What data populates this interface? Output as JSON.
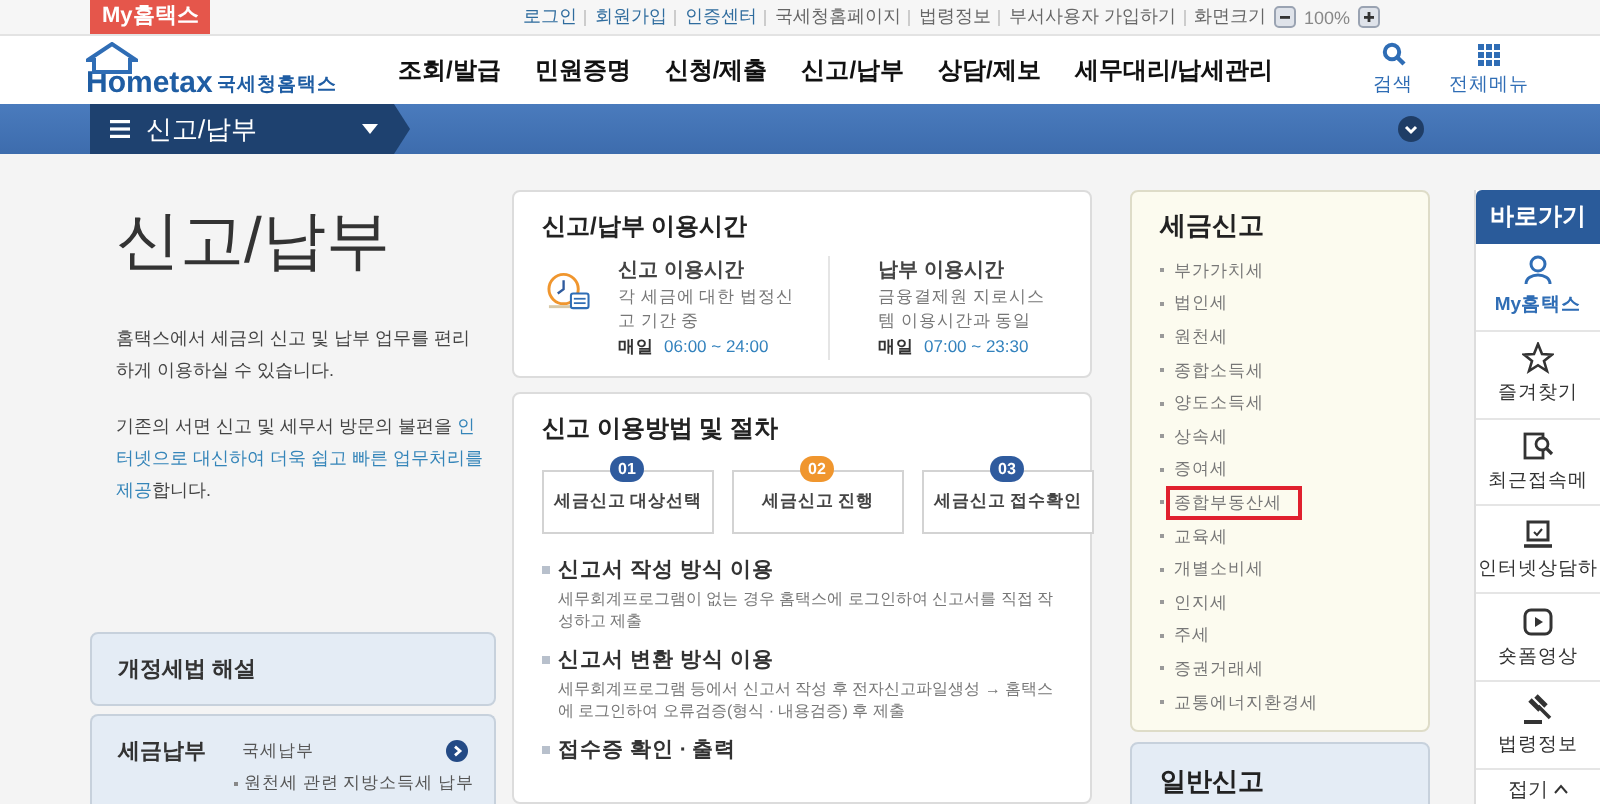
{
  "top_bar": {
    "badge": "My홈택스",
    "links": [
      {
        "label": "로그인",
        "emphasis": true
      },
      {
        "label": "회원가입",
        "emphasis": true
      },
      {
        "label": "인증센터",
        "emphasis": true
      },
      {
        "label": "국세청홈페이지",
        "emphasis": false
      },
      {
        "label": "법령정보",
        "emphasis": false
      },
      {
        "label": "부서사용자 가입하기",
        "emphasis": false
      },
      {
        "label": "화면크기",
        "emphasis": false
      }
    ],
    "zoom": "100%"
  },
  "header": {
    "logo_text": "Hometax",
    "logo_subtitle": "국세청홈택스",
    "menu": [
      "조회/발급",
      "민원증명",
      "신청/제출",
      "신고/납부",
      "상담/제보",
      "세무대리/납세관리"
    ],
    "search_label": "검색",
    "all_menu_label": "전체메뉴"
  },
  "breadcrumb_bar": {
    "current": "신고/납부"
  },
  "intro": {
    "title": "신고/납부",
    "paragraphs": [
      {
        "text": "홈택스에서 세금의 신고 및 납부 업무를 편리하게 이용하실 수 있습니다."
      },
      {
        "text": "기존의 서면 신고 및 세무서 방문의 불편을 ",
        "highlight": "인터넷으로 대신하여 더욱 쉽고 빠른 업무처리를 제공",
        "after": "합니다."
      }
    ]
  },
  "left_panels": [
    {
      "title": "개정세법 해설"
    },
    {
      "title": "세금납부",
      "link": "국세납부",
      "items": [
        "원천세 관련 지방소득세 납부"
      ]
    }
  ],
  "usage_hours": {
    "title": "신고/납부 이용시간",
    "columns": [
      {
        "title": "신고 이용시간",
        "desc": "각 세금에 대한 법정신고 기간 중",
        "label": "매일",
        "time": "06:00 ~ 24:00"
      },
      {
        "title": "납부 이용시간",
        "desc": "금융결제원 지로시스템 이용시간과 동일",
        "label": "매일",
        "time": "07:00 ~ 23:30"
      }
    ]
  },
  "procedure": {
    "title": "신고 이용방법 및 절차",
    "steps": [
      {
        "number": "01",
        "label": "세금신고 대상선택",
        "color": "#2f5b9e"
      },
      {
        "number": "02",
        "label": "세금신고 진행",
        "color": "#f0962e"
      },
      {
        "number": "03",
        "label": "세금신고 접수확인",
        "color": "#2f5b9e"
      }
    ],
    "methods": [
      {
        "title": "신고서 작성 방식 이용",
        "desc": "세무회계프로그램이 없는 경우 홈택스에 로그인하여 신고서를 직접 작성하고 제출"
      },
      {
        "title": "신고서 변환 방식 이용",
        "desc": "세무회계프로그램 등에서 신고서 작성 후 전자신고파일생성 → 홈택스에 로그인하여 오류검증(형식 · 내용검증) 후 제출"
      },
      {
        "title": "접수증 확인 · 출력"
      }
    ]
  },
  "tax_filing": {
    "title": "세금신고",
    "items": [
      {
        "label": "부가가치세",
        "highlighted": false
      },
      {
        "label": "법인세",
        "highlighted": false
      },
      {
        "label": "원천세",
        "highlighted": false
      },
      {
        "label": "종합소득세",
        "highlighted": false
      },
      {
        "label": "양도소득세",
        "highlighted": false
      },
      {
        "label": "상속세",
        "highlighted": false
      },
      {
        "label": "증여세",
        "highlighted": false
      },
      {
        "label": "종합부동산세",
        "highlighted": true
      },
      {
        "label": "교육세",
        "highlighted": false
      },
      {
        "label": "개별소비세",
        "highlighted": false
      },
      {
        "label": "인지세",
        "highlighted": false
      },
      {
        "label": "주세",
        "highlighted": false
      },
      {
        "label": "증권거래세",
        "highlighted": false
      },
      {
        "label": "교통에너지환경세",
        "highlighted": false
      }
    ]
  },
  "general_filing": {
    "title": "일반신고"
  },
  "quick_links": {
    "title": "바로가기",
    "items": [
      {
        "label": "My홈택스",
        "kind": "person",
        "selected": true
      },
      {
        "label": "즐겨찾기",
        "kind": "star",
        "selected": false
      },
      {
        "label": "최근접속메",
        "kind": "recent",
        "selected": false
      },
      {
        "label": "인터넷상담하",
        "kind": "laptop",
        "selected": false
      },
      {
        "label": "숏폼영상",
        "kind": "video",
        "selected": false
      },
      {
        "label": "법령정보",
        "kind": "gavel",
        "selected": false
      }
    ],
    "collapse": "접기"
  }
}
